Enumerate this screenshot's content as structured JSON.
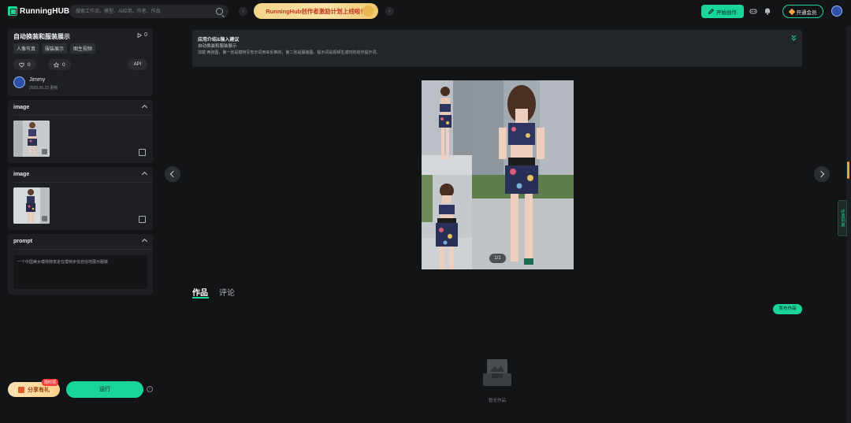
{
  "header": {
    "logo_text": "RunningHUB",
    "search_placeholder": "搜索工作流、模型、AI应用、作者、作品",
    "banner_text": "RunningHub创作者激励计划上线啦！",
    "pager_prev": "‹",
    "pager_next": "›",
    "create_label": "开始创作",
    "member_label": "开通会员",
    "colors": {
      "accent": "#19d59b",
      "banner_text": "#c3341f"
    }
  },
  "app": {
    "title": "自动换装和服装展示",
    "play_count": "0",
    "tags": [
      "人像写真",
      "服装展示",
      "图生视频"
    ],
    "likes": "0",
    "favorites": "0",
    "api_label": "API",
    "author": {
      "name": "Jimmy",
      "date": "2025.06.23 更新"
    }
  },
  "inputs": [
    {
      "label": "image"
    },
    {
      "label": "image"
    },
    {
      "label": "prompt",
      "value": "一个中国美女模特随意走在模特步伐自信地展示服装"
    }
  ],
  "footer": {
    "share_label": "分享有礼",
    "share_badge": "限时领",
    "run_label": "运行"
  },
  "intro": {
    "title": "应用介绍&输入建议",
    "subtitle": "自动换装和服装展示",
    "body": "加载 两张图，第一张是模特写安示词用来反推的，第二张是服装图。提示词是视频生成时的动作提示词。"
  },
  "preview": {
    "page_indicator": "1/1",
    "watermark": "RunningHUB.ai"
  },
  "tabs": [
    {
      "label": "作品",
      "active": true
    },
    {
      "label": "评论",
      "active": false
    }
  ],
  "publish_label": "发布作品",
  "empty_text": "暂无作品",
  "side_float_label": "任务列表"
}
